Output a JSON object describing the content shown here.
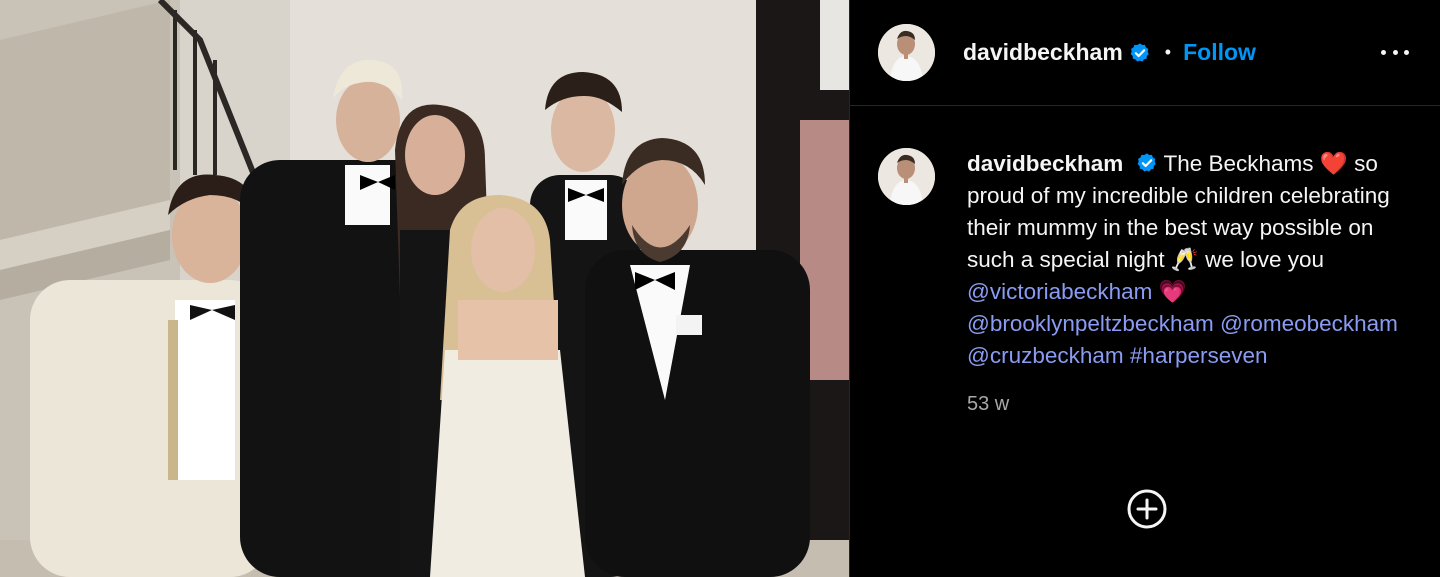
{
  "post": {
    "photo_alt": "",
    "header": {
      "username": "davidbeckham",
      "separator": "•",
      "follow_label": "Follow"
    },
    "caption": {
      "username": "davidbeckham",
      "text_1": "The Beckhams",
      "emoji_heart": "❤️",
      "text_2": "so proud of my incredible children celebrating their mummy in the best way possible on such a special night",
      "emoji_glasses": "🥂",
      "text_3": "we love you",
      "mention_1": "@victoriabeckham",
      "emoji_pink_heart": "💗",
      "mention_2": "@brooklynpeltzbeckham",
      "mention_3": "@romeobeckham",
      "mention_4": "@cruzbeckham",
      "hashtag": "#harperseven"
    },
    "timestamp": "53 w"
  },
  "colors": {
    "background": "#000000",
    "follow": "#0095f6",
    "link": "#8a9cf2",
    "verified": "#0095f6",
    "muted": "#a8a8a8"
  },
  "icons": {
    "verified": "verified-badge-icon",
    "more": "more-options-icon",
    "add": "add-comment-icon"
  }
}
